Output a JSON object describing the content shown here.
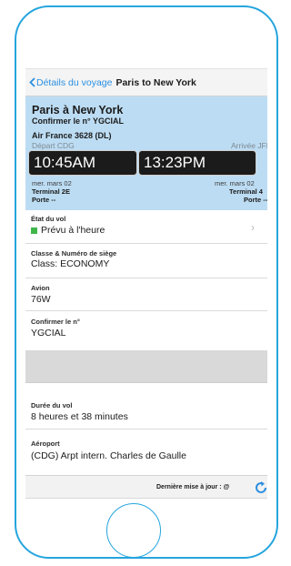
{
  "nav": {
    "back_label": "Détails du voyage",
    "title": "Paris to New York"
  },
  "flight": {
    "route": "Paris à New York",
    "confirmation": "Confirmer le n° YGCIAL",
    "airline_number": "Air France 3628 (DL)",
    "departure": {
      "label": "Départ CDG",
      "time": "10:45AM",
      "date": "mer. mars 02",
      "terminal": "Terminal 2E",
      "gate": "Porte --"
    },
    "arrival": {
      "label": "Arrivée JFK",
      "time": "13:23PM",
      "date": "mer. mars 02",
      "terminal": "Terminal 4",
      "gate": "Porte --"
    }
  },
  "details": {
    "status": {
      "label": "État du vol",
      "value": "Prévu à l'heure",
      "color": "#3fb64a"
    },
    "seat": {
      "label": "Classe & Numéro de siège",
      "value": "Class: ECONOMY"
    },
    "aircraft": {
      "label": "Avion",
      "value": "76W"
    },
    "confirm": {
      "label": "Confirmer le n°",
      "value": "YGCIAL"
    },
    "duration": {
      "label": "Durée du vol",
      "value": "8 heures et 38 minutes"
    },
    "airport": {
      "label": "Aéroport",
      "value": "(CDG) Arpt intern. Charles de Gaulle"
    }
  },
  "footer": {
    "last_update": "Dernière mise à jour : @"
  },
  "icons": {
    "back": "chevron-left-icon",
    "disclosure": "chevron-right-icon",
    "refresh": "refresh-icon"
  },
  "colors": {
    "accent": "#2b8fe0",
    "header_bg": "#bcdcf3",
    "frame": "#25a5de"
  }
}
